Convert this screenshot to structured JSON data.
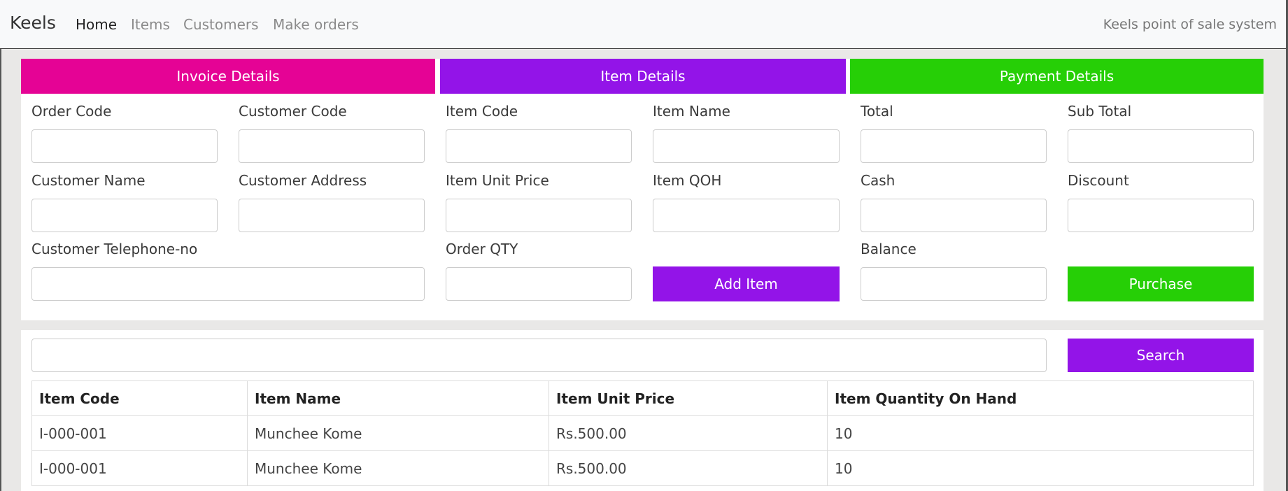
{
  "navbar": {
    "brand": "Keels",
    "links": [
      "Home",
      "Items",
      "Customers",
      "Make orders"
    ],
    "right_text": "Keels point of sale system"
  },
  "sections": {
    "invoice": "Invoice Details",
    "item": "Item Details",
    "payment": "Payment Details"
  },
  "invoice": {
    "order_code": "Order Code",
    "customer_code": "Customer Code",
    "customer_name": "Customer Name",
    "customer_address": "Customer Address",
    "customer_telephone": "Customer Telephone-no"
  },
  "item": {
    "item_code": "Item Code",
    "item_name": "Item Name",
    "item_unit_price": "Item Unit Price",
    "item_qoh": "Item QOH",
    "order_qty": "Order QTY",
    "add_button": "Add Item"
  },
  "payment": {
    "total": "Total",
    "sub_total": "Sub Total",
    "cash": "Cash",
    "discount": "Discount",
    "balance": "Balance",
    "purchase_button": "Purchase"
  },
  "search": {
    "button": "Search",
    "value": ""
  },
  "table": {
    "headers": [
      "Item Code",
      "Item Name",
      "Item Unit Price",
      "Item Quantity On Hand"
    ],
    "rows": [
      [
        "I-000-001",
        "Munchee Kome",
        "Rs.500.00",
        "10"
      ],
      [
        "I-000-001",
        "Munchee Kome",
        "Rs.500.00",
        "10"
      ]
    ]
  },
  "colors": {
    "invoice": "#e50395",
    "item": "#9314e8",
    "payment": "#26cf06"
  }
}
